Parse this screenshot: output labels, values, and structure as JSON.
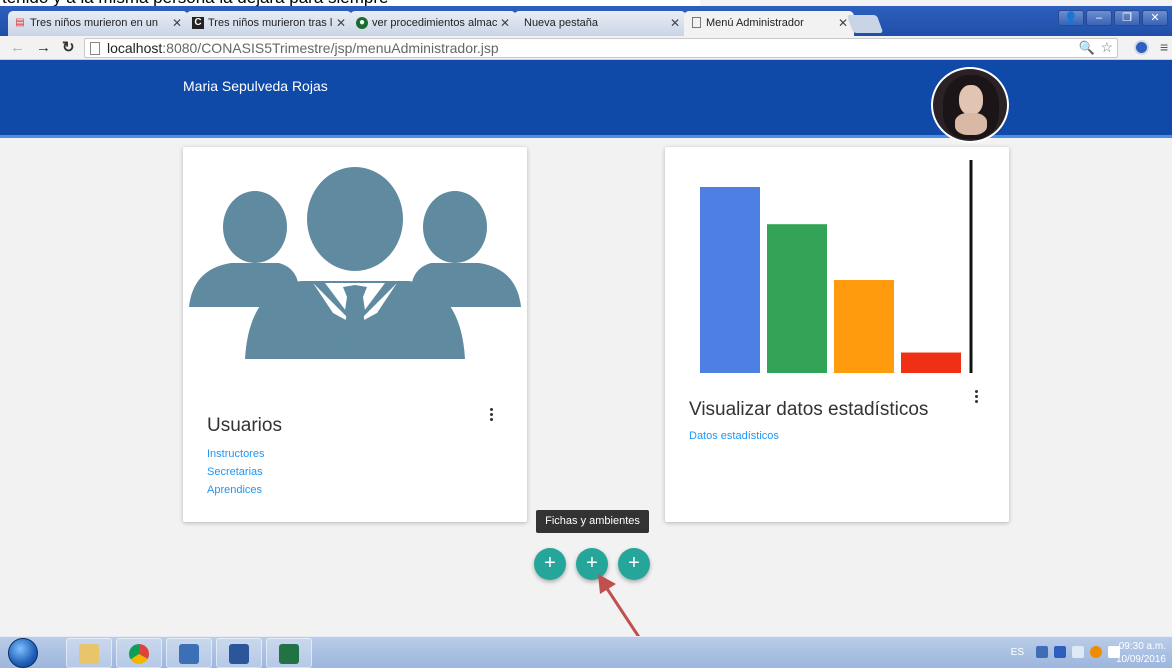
{
  "browser": {
    "tabs": [
      {
        "label": "Tres niños murieron en un",
        "favicon": "news-icon"
      },
      {
        "label": "Tres niños murieron tras l",
        "favicon": "c-icon"
      },
      {
        "label": "ver procedimientos almac",
        "favicon": "stack-icon"
      },
      {
        "label": "Nueva pestaña",
        "favicon": ""
      },
      {
        "label": "Menú Administrador",
        "favicon": "page-icon"
      }
    ],
    "url_host": "localhost",
    "url_path": ":8080/CONASIS5Trimestre/jsp/menuAdministrador.jsp"
  },
  "header": {
    "username": "Maria Sepulveda Rojas",
    "bg_color": "#0f4aa8"
  },
  "cards": {
    "users": {
      "title": "Usuarios",
      "links": [
        "Instructores",
        "Secretarias",
        "Aprendices"
      ]
    },
    "stats": {
      "title": "Visualizar datos estadísticos",
      "links": [
        "Datos estadísticos"
      ]
    }
  },
  "tooltip": "Fichas y ambientes",
  "fabs": [
    "+",
    "+",
    "+"
  ],
  "chart_data": {
    "type": "bar",
    "categories": [
      "",
      "",
      "",
      ""
    ],
    "values": [
      100,
      80,
      50,
      11
    ],
    "colors": [
      "#4e7fe3",
      "#33a457",
      "#ff9a0c",
      "#f03015"
    ],
    "title": "",
    "xlabel": "",
    "ylabel": "",
    "ylim": [
      0,
      100
    ]
  },
  "taskbar": {
    "lang": "ES",
    "time": "09:30 a.m.",
    "date": "10/09/2016"
  }
}
